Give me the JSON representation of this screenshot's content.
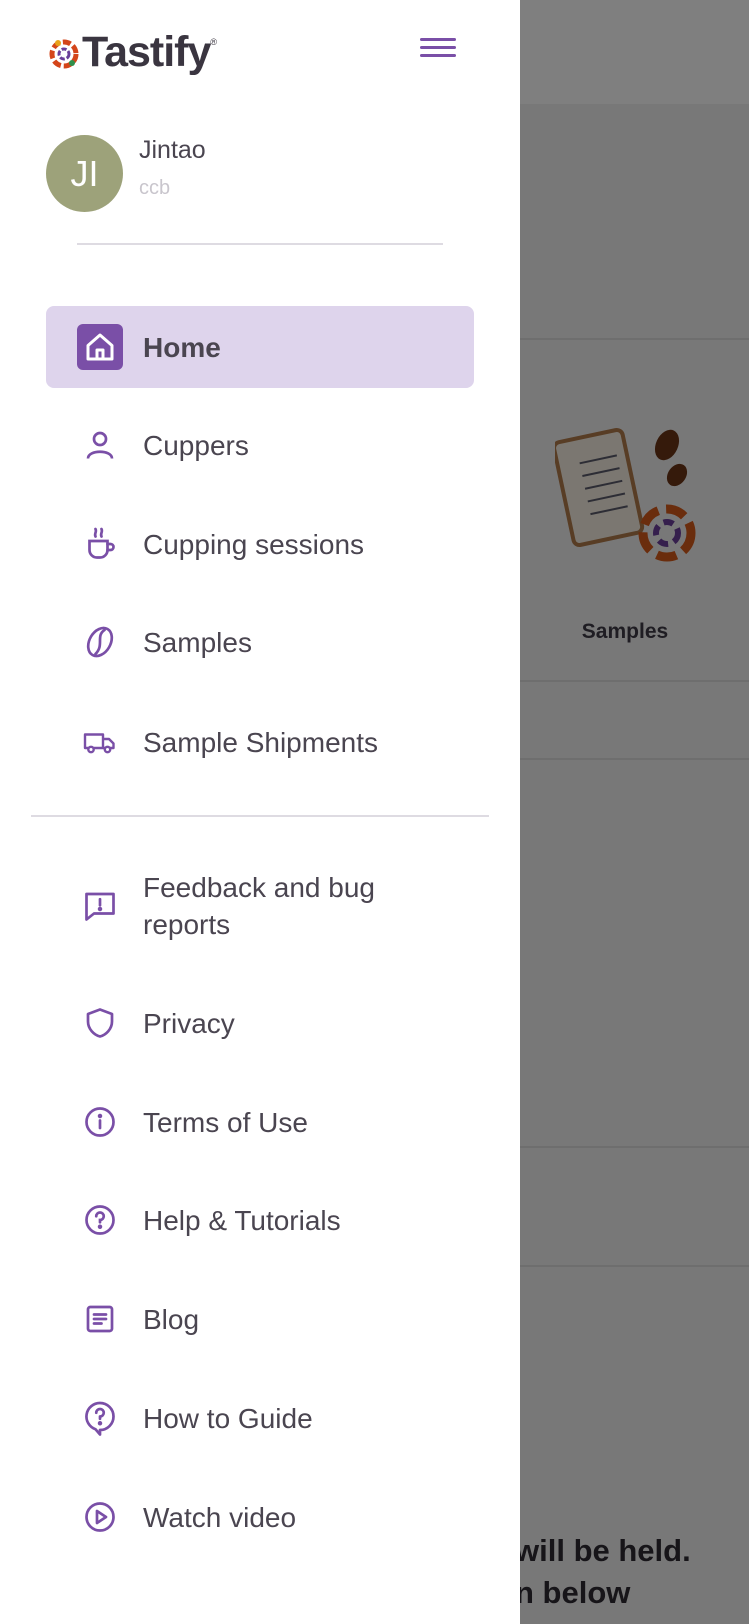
{
  "app": {
    "name": "Tastify",
    "trademark": "®"
  },
  "user": {
    "initials": "JI",
    "name": "Jintao",
    "organization": "ccb"
  },
  "nav": {
    "primary": [
      {
        "label": "Home",
        "icon": "home-icon",
        "active": true
      },
      {
        "label": "Cuppers",
        "icon": "person-icon"
      },
      {
        "label": "Cupping sessions",
        "icon": "cup-icon"
      },
      {
        "label": "Samples",
        "icon": "coffee-bean-icon"
      },
      {
        "label": "Sample Shipments",
        "icon": "truck-icon"
      }
    ],
    "secondary": [
      {
        "label": "Feedback and bug reports",
        "icon": "feedback-icon"
      },
      {
        "label": "Privacy",
        "icon": "shield-icon"
      },
      {
        "label": "Terms of Use",
        "icon": "info-icon"
      },
      {
        "label": "Help & Tutorials",
        "icon": "help-icon"
      },
      {
        "label": "Blog",
        "icon": "article-icon"
      },
      {
        "label": "How to Guide",
        "icon": "guide-icon"
      },
      {
        "label": "Watch video",
        "icon": "play-icon"
      }
    ]
  },
  "background": {
    "card_label": "Samples",
    "bottom_text_line1": "will be held.",
    "bottom_text_line2": "n below"
  },
  "colors": {
    "accent": "#7a4fa7",
    "active_bg": "#ded4ec",
    "avatar": "#9da27a"
  }
}
